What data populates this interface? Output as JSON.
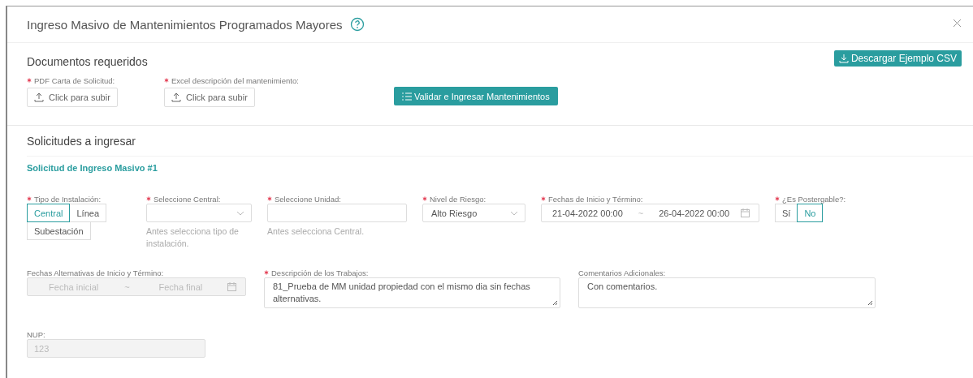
{
  "dialog": {
    "title": "Ingreso Masivo de Mantenimientos Programados Mayores"
  },
  "documents": {
    "heading": "Documentos requeridos",
    "download_button": "Descargar Ejemplo CSV",
    "uploads": [
      {
        "label": "PDF Carta de Solicitud:",
        "required": true,
        "button": "Click para subir"
      },
      {
        "label": "Excel descripción del mantenimiento:",
        "required": true,
        "button": "Click para subir"
      }
    ],
    "validate_button": "Validar e Ingresar Mantenimientos"
  },
  "requests": {
    "heading": "Solicitudes a ingresar",
    "items": [
      {
        "title": "Solicitud de Ingreso Masivo #1",
        "rows": [
          {
            "fields": [
              {
                "kind": "segmented",
                "label": "Tipo de Instalación:",
                "required": true,
                "options": [
                  {
                    "label": "Central",
                    "selected": true
                  },
                  {
                    "label": "Línea",
                    "selected": false
                  },
                  {
                    "label": "Subestación",
                    "selected": false
                  }
                ]
              },
              {
                "kind": "select",
                "label": "Seleccione Central:",
                "required": true,
                "hint": "Antes selecciona tipo de instalación."
              },
              {
                "kind": "input",
                "label": "Seleccione Unidad:",
                "required": true,
                "hint": "Antes selecciona Central."
              },
              {
                "kind": "select",
                "label": "Nivel de Riesgo:",
                "required": true,
                "value": "Alto Riesgo"
              },
              {
                "kind": "daterange",
                "label": "Fechas de Inicio y Término:",
                "required": true,
                "start": "21-04-2022 00:00",
                "end": "26-04-2022 00:00",
                "separator": "~",
                "disabled": false
              },
              {
                "kind": "segmented",
                "label": "¿Es Postergable?:",
                "required": true,
                "options": [
                  {
                    "label": "Sí",
                    "selected": false
                  },
                  {
                    "label": "No",
                    "selected": true
                  }
                ]
              }
            ]
          },
          {
            "fields": [
              {
                "kind": "daterange",
                "label": "Fechas Alternativas de Inicio y Término:",
                "required": false,
                "start_placeholder": "Fecha inicial",
                "end_placeholder": "Fecha final",
                "separator": "~",
                "disabled": true
              },
              {
                "kind": "textarea",
                "label": "Descripción de los Trabajos:",
                "required": true,
                "value": "81_Prueba de MM unidad propiedad con el mismo dia sin fechas alternativas."
              },
              {
                "kind": "textarea",
                "label": "Comentarios Adicionales:",
                "required": false,
                "value": "Con comentarios."
              }
            ]
          },
          {
            "fields": [
              {
                "kind": "input",
                "label": "NUP:",
                "required": false,
                "value": "123",
                "disabled": true
              }
            ]
          }
        ]
      }
    ]
  }
}
